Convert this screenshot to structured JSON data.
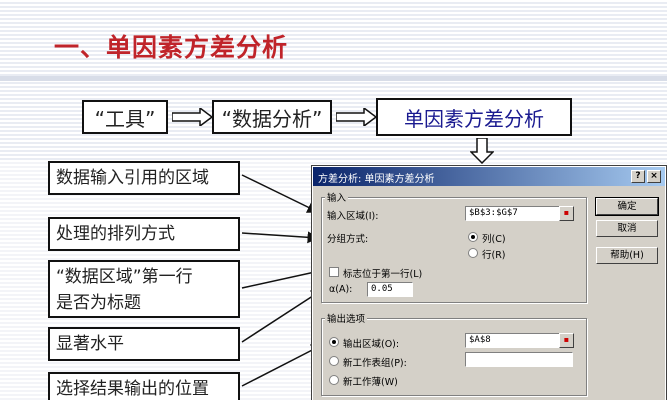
{
  "slide": {
    "title": "一、单因素方差分析",
    "flow": {
      "step1": "“工具”",
      "step2": "“数据分析”",
      "step3": "单因素方差分析"
    },
    "callouts": [
      "数据输入引用的区域",
      "处理的排列方式",
      "“数据区域”第一行",
      "是否为标题",
      "显著水平",
      "选择结果输出的位置"
    ]
  },
  "dialog": {
    "title": "方差分析: 单因素方差分析",
    "title_buttons": {
      "help": "?",
      "close": "×"
    },
    "input_group": {
      "label": "输入",
      "range_label": "输入区域(I):",
      "range_value": "$B$3:$G$7",
      "grouping_label": "分组方式:",
      "by_column_label": "列(C)",
      "by_row_label": "行(R)",
      "labels_checkbox": "标志位于第一行(L)",
      "alpha_label": "α(A):",
      "alpha_value": "0.05"
    },
    "output_group": {
      "label": "输出选项",
      "output_range_label": "输出区域(O):",
      "output_range_value": "$A$8",
      "new_sheet_label": "新工作表组(P):",
      "new_workbook_label": "新工作薄(W)"
    },
    "buttons": {
      "ok": "确定",
      "cancel": "取消",
      "help": "帮助(H)"
    }
  }
}
